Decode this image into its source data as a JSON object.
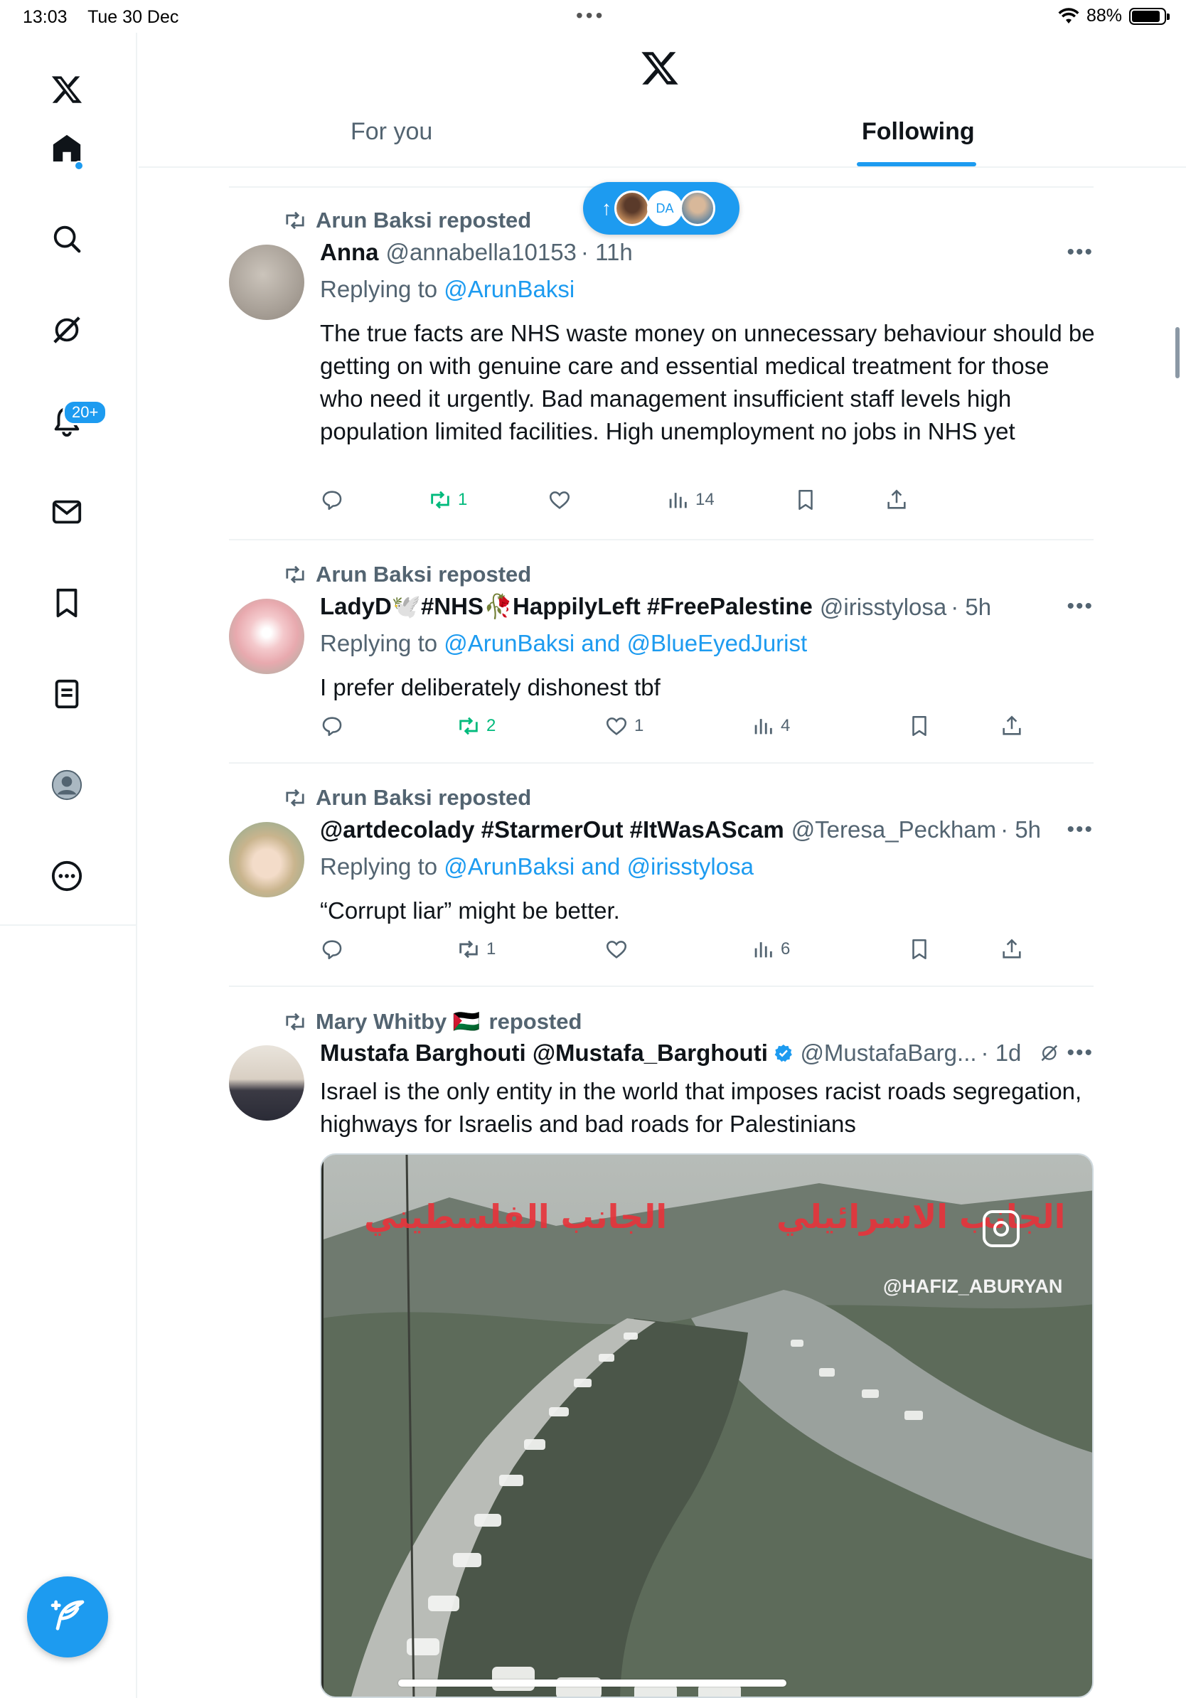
{
  "status_bar": {
    "time": "13:03",
    "date": "Tue 30 Dec",
    "battery": "88%"
  },
  "header": {
    "tabs": [
      {
        "label": "For you",
        "active": false
      },
      {
        "label": "Following",
        "active": true
      }
    ]
  },
  "sidebar": {
    "icons": [
      "x-logo-icon",
      "home-icon",
      "search-icon",
      "grok-icon",
      "notifications-icon",
      "messages-icon",
      "bookmarks-icon",
      "lists-icon",
      "profile-icon",
      "more-icon"
    ],
    "notifications_badge": "20+"
  },
  "colors": {
    "accent": "#1d9bf0",
    "text": "#0f1419",
    "muted": "#536471",
    "green": "#00ba7c"
  },
  "posts": [
    {
      "reposted_by": "Arun Baksi reposted",
      "name": "Anna",
      "handle": "@annabella10153",
      "time": "· 11h",
      "replying_prefix": "Replying to ",
      "replying_to": "@ArunBaksi",
      "text": "The true facts are NHS waste money on unnecessary behaviour should be getting on with genuine care and essential medical treatment for those who need it urgently. Bad management insufficient staff levels high population limited facilities. High unemployment no jobs in NHS yet",
      "reposts": "1",
      "likes": "",
      "views": "14"
    },
    {
      "reposted_by": "Arun Baksi reposted",
      "name": "LadyD🕊️#NHS🥀HappilyLeft #FreePalestine",
      "handle": "@irisstylosa",
      "time": "· 5h",
      "replying_prefix": "Replying to ",
      "replying_to": "@ArunBaksi and @BlueEyedJurist",
      "text": "I prefer deliberately dishonest tbf",
      "reposts": "2",
      "likes": "1",
      "views": "4"
    },
    {
      "reposted_by": "Arun Baksi reposted",
      "name": "@artdecolady #StarmerOut #ItWasAScam",
      "handle": "@Teresa_Peckham",
      "time": "· 5h",
      "replying_prefix": "Replying to ",
      "replying_to": "@ArunBaksi and @irisstylosa",
      "text": "“Corrupt liar” might be better.",
      "reposts": "1",
      "likes": "",
      "views": "6"
    },
    {
      "reposted_by_name": "Mary Whitby 🇵🇸",
      "reposted_by_suffix": "reposted",
      "name": "Mustafa Barghouti @Mustafa_Barghouti",
      "handle": "@MustafaBarg...",
      "time": "· 1d",
      "text": "Israel  is the only entity in the world that imposes racist roads segregation, highways for Israelis and bad roads for Palestinians",
      "media": {
        "overlay_left": "الجانب الفلسطيني",
        "overlay_right": "الجانب الاسرائيلي",
        "watermark": "@HAFIZ_ABURYAN"
      }
    }
  ]
}
